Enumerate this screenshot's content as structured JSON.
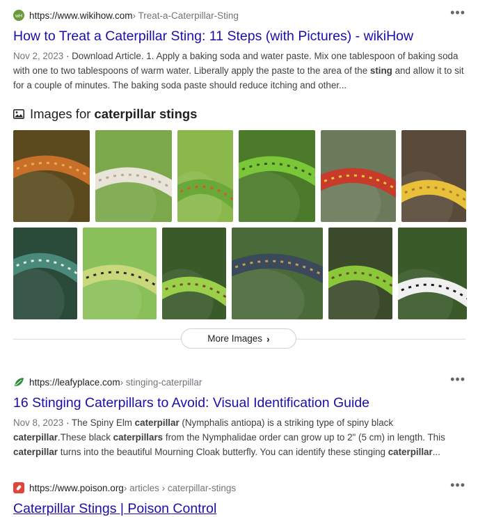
{
  "results": [
    {
      "url": "https://www.wikihow.com",
      "crumb": " › Treat-a-Caterpillar-Sting",
      "title": "How to Treat a Caterpillar Sting: 11 Steps (with Pictures) - wikiHow",
      "date": "Nov 2, 2023",
      "snippet_parts": [
        {
          "t": " · Download Article. 1. Apply a baking soda and water paste. Mix one tablespoon of baking soda with one to two tablespoons of warm water. Liberally apply the paste to the area of the ",
          "b": false
        },
        {
          "t": "sting",
          "b": true
        },
        {
          "t": " and allow it to sit for a couple of minutes. The baking soda paste should reduce itching and other...",
          "b": false
        }
      ],
      "favicon_color": "#6a9a3b"
    },
    {
      "url": "https://leafyplace.com",
      "crumb": " › stinging-caterpillar",
      "title": "16 Stinging Caterpillars to Avoid: Visual Identification Guide",
      "date": "Nov 8, 2023",
      "snippet_parts": [
        {
          "t": " · The Spiny Elm ",
          "b": false
        },
        {
          "t": "caterpillar",
          "b": true
        },
        {
          "t": " (Nymphalis antiopa) is a striking type of spiny black ",
          "b": false
        },
        {
          "t": "caterpillar",
          "b": true
        },
        {
          "t": ".These black ",
          "b": false
        },
        {
          "t": "caterpillars",
          "b": true
        },
        {
          "t": " from the Nymphalidae order can grow up to 2\" (5 cm) in length. This ",
          "b": false
        },
        {
          "t": "caterpillar",
          "b": true
        },
        {
          "t": " turns into the beautiful Mourning Cloak butterfly. You can identify these stinging ",
          "b": false
        },
        {
          "t": "caterpillar",
          "b": true
        },
        {
          "t": "...",
          "b": false
        }
      ],
      "favicon_color": "#2e8b3a"
    },
    {
      "url": "https://www.poison.org",
      "crumb": " › articles › caterpillar-stings",
      "title": "Caterpillar Stings | Poison Control",
      "favicon_color": "#e0453a"
    }
  ],
  "images": {
    "prefix": "Images for ",
    "query": "caterpillar stings",
    "more_label": "More Images",
    "row1": [
      {
        "desc": "orange spiny caterpillar",
        "bg": "#5a4a1e",
        "body": "#c8702a",
        "accent": "#e8b04a"
      },
      {
        "desc": "white hairy caterpillar",
        "bg": "#7aa84a",
        "body": "#e8e4d8",
        "accent": "#b8a898"
      },
      {
        "desc": "green spiny caterpillar on leaf",
        "bg": "#8ab84a",
        "body": "#6aa83a",
        "accent": "#d85a2a"
      },
      {
        "desc": "green spiked caterpillar",
        "bg": "#4a7a2a",
        "body": "#7ac83a",
        "accent": "#3a5a1a"
      },
      {
        "desc": "red and yellow spiny caterpillar",
        "bg": "#6a7a5a",
        "body": "#c83a2a",
        "accent": "#f0c83a"
      },
      {
        "desc": "yellow spiny caterpillar",
        "bg": "#5a4a3a",
        "body": "#e8c03a",
        "accent": "#a87a2a"
      }
    ],
    "row2": [
      {
        "desc": "teal spiny caterpillar",
        "bg": "#2a4a3a",
        "body": "#4a8a7a",
        "accent": "#e8e8e0"
      },
      {
        "desc": "green caterpillar with bristles",
        "bg": "#8ac05a",
        "body": "#c8d87a",
        "accent": "#2a2a2a"
      },
      {
        "desc": "green saddleback caterpillar",
        "bg": "#3a5a2a",
        "body": "#9ad04a",
        "accent": "#7a4a2a"
      },
      {
        "desc": "striped hairy caterpillar",
        "bg": "#4a6a3a",
        "body": "#3a4a5a",
        "accent": "#c89a5a"
      },
      {
        "desc": "saddleback caterpillar on bark",
        "bg": "#3a4a2a",
        "body": "#8ac83a",
        "accent": "#6a4a2a"
      },
      {
        "desc": "white black hairy caterpillar",
        "bg": "#3a5a2a",
        "body": "#f0f0f0",
        "accent": "#1a1a1a"
      }
    ]
  }
}
